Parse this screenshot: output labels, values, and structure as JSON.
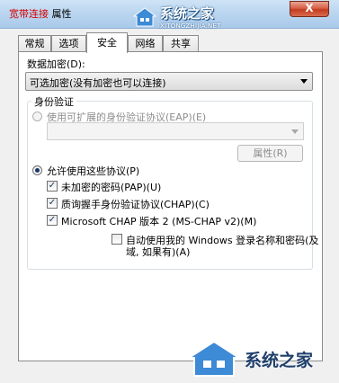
{
  "window": {
    "title_prefix": "宽带连接",
    "title_suffix": "属性",
    "close_label": "X"
  },
  "watermark": {
    "name": "系统之家",
    "url": "XITONGZHIJIA.NET"
  },
  "tabs": [
    {
      "label": "常规",
      "active": false
    },
    {
      "label": "选项",
      "active": false
    },
    {
      "label": "安全",
      "active": true
    },
    {
      "label": "网络",
      "active": false
    },
    {
      "label": "共享",
      "active": false
    }
  ],
  "security": {
    "encryption_label": "数据加密(D):",
    "encryption_value": "可选加密(没有加密也可以连接)",
    "auth_group_title": "身份验证",
    "eap_radio_label": "使用可扩展的身份验证协议(EAP)(E)",
    "eap_select_value": "",
    "properties_button": "属性(R)",
    "allow_protocols_label": "允许使用这些协议(P)",
    "protocols": [
      {
        "label": "未加密的密码(PAP)(U)",
        "checked": true
      },
      {
        "label": "质询握手身份验证协议(CHAP)(C)",
        "checked": true
      },
      {
        "label": "Microsoft CHAP 版本 2 (MS-CHAP v2)(M)",
        "checked": true
      }
    ],
    "auto_logon_line1": "自动使用我的 Windows 登录名称和密码(及",
    "auto_logon_line2": "域, 如果有)(A)",
    "auto_logon_checked": false
  }
}
